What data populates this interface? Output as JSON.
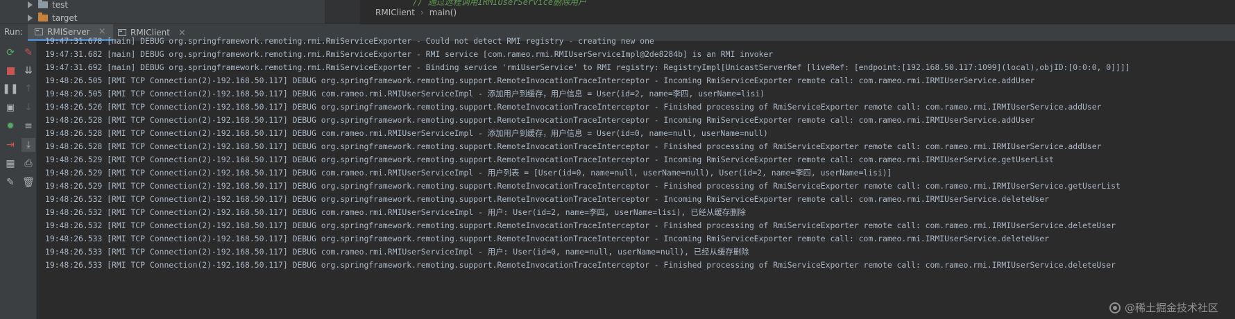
{
  "project_tree": {
    "items": [
      {
        "label": "test",
        "icon": "folder-icon"
      },
      {
        "label": "target",
        "icon": "folder-orange-icon"
      }
    ]
  },
  "editor": {
    "code_fragment": "// 通过远程调用IRMIUserService删除用户",
    "breadcrumb": [
      "RMIClient",
      "main()"
    ]
  },
  "run_panel": {
    "label": "Run:",
    "tabs": [
      {
        "label": "RMIServer",
        "active": true
      },
      {
        "label": "RMIClient",
        "active": false
      }
    ]
  },
  "toolbar_icons": {
    "left": [
      "rerun-icon",
      "stop-icon",
      "pause-icon",
      "camera-icon",
      "debug-icon",
      "exit-icon",
      "layout-icon",
      "pin-icon"
    ],
    "right": [
      "clear-icon",
      "sort-down-icon",
      "up-arrow-icon",
      "down-arrow-icon",
      "soft-wrap-icon",
      "scroll-to-end-icon",
      "print-icon",
      "trash-icon"
    ]
  },
  "console_lines": [
    "19:47:31.678 [main] DEBUG org.springframework.remoting.rmi.RmiServiceExporter - Could not detect RMI registry - creating new one",
    "19:47:31.682 [main] DEBUG org.springframework.remoting.rmi.RmiServiceExporter - RMI service [com.rameo.rmi.RMIUserServiceImpl@2de8284b] is an RMI invoker",
    "19:47:31.692 [main] DEBUG org.springframework.remoting.rmi.RmiServiceExporter - Binding service 'rmiUserService' to RMI registry: RegistryImpl[UnicastServerRef [liveRef: [endpoint:[192.168.50.117:1099](local),objID:[0:0:0, 0]]]]",
    "19:48:26.505 [RMI TCP Connection(2)-192.168.50.117] DEBUG org.springframework.remoting.support.RemoteInvocationTraceInterceptor - Incoming RmiServiceExporter remote call: com.rameo.rmi.IRMIUserService.addUser",
    "19:48:26.505 [RMI TCP Connection(2)-192.168.50.117] DEBUG com.rameo.rmi.RMIUserServiceImpl - 添加用户到缓存，用户信息 = User(id=2, name=李四, userName=lisi)",
    "19:48:26.526 [RMI TCP Connection(2)-192.168.50.117] DEBUG org.springframework.remoting.support.RemoteInvocationTraceInterceptor - Finished processing of RmiServiceExporter remote call: com.rameo.rmi.IRMIUserService.addUser",
    "19:48:26.528 [RMI TCP Connection(2)-192.168.50.117] DEBUG org.springframework.remoting.support.RemoteInvocationTraceInterceptor - Incoming RmiServiceExporter remote call: com.rameo.rmi.IRMIUserService.addUser",
    "19:48:26.528 [RMI TCP Connection(2)-192.168.50.117] DEBUG com.rameo.rmi.RMIUserServiceImpl - 添加用户到缓存，用户信息 = User(id=0, name=null, userName=null)",
    "19:48:26.528 [RMI TCP Connection(2)-192.168.50.117] DEBUG org.springframework.remoting.support.RemoteInvocationTraceInterceptor - Finished processing of RmiServiceExporter remote call: com.rameo.rmi.IRMIUserService.addUser",
    "19:48:26.529 [RMI TCP Connection(2)-192.168.50.117] DEBUG org.springframework.remoting.support.RemoteInvocationTraceInterceptor - Incoming RmiServiceExporter remote call: com.rameo.rmi.IRMIUserService.getUserList",
    "19:48:26.529 [RMI TCP Connection(2)-192.168.50.117] DEBUG com.rameo.rmi.RMIUserServiceImpl - 用户列表 = [User(id=0, name=null, userName=null), User(id=2, name=李四, userName=lisi)]",
    "19:48:26.529 [RMI TCP Connection(2)-192.168.50.117] DEBUG org.springframework.remoting.support.RemoteInvocationTraceInterceptor - Finished processing of RmiServiceExporter remote call: com.rameo.rmi.IRMIUserService.getUserList",
    "19:48:26.532 [RMI TCP Connection(2)-192.168.50.117] DEBUG org.springframework.remoting.support.RemoteInvocationTraceInterceptor - Incoming RmiServiceExporter remote call: com.rameo.rmi.IRMIUserService.deleteUser",
    "19:48:26.532 [RMI TCP Connection(2)-192.168.50.117] DEBUG com.rameo.rmi.RMIUserServiceImpl - 用户: User(id=2, name=李四, userName=lisi), 已经从缓存删除",
    "19:48:26.532 [RMI TCP Connection(2)-192.168.50.117] DEBUG org.springframework.remoting.support.RemoteInvocationTraceInterceptor - Finished processing of RmiServiceExporter remote call: com.rameo.rmi.IRMIUserService.deleteUser",
    "19:48:26.533 [RMI TCP Connection(2)-192.168.50.117] DEBUG org.springframework.remoting.support.RemoteInvocationTraceInterceptor - Incoming RmiServiceExporter remote call: com.rameo.rmi.IRMIUserService.deleteUser",
    "19:48:26.533 [RMI TCP Connection(2)-192.168.50.117] DEBUG com.rameo.rmi.RMIUserServiceImpl - 用户: User(id=0, name=null, userName=null), 已经从缓存删除",
    "19:48:26.533 [RMI TCP Connection(2)-192.168.50.117] DEBUG org.springframework.remoting.support.RemoteInvocationTraceInterceptor - Finished processing of RmiServiceExporter remote call: com.rameo.rmi.IRMIUserService.deleteUser"
  ],
  "watermark": "@稀土掘金技术社区"
}
